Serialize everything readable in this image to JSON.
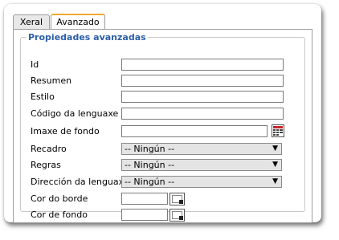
{
  "tabs": [
    {
      "label": "Xeral",
      "active": false
    },
    {
      "label": "Avanzado",
      "active": true
    }
  ],
  "fieldset": {
    "legend": "Propiedades avanzadas"
  },
  "fields": {
    "id": {
      "label": "Id",
      "value": ""
    },
    "resumen": {
      "label": "Resumen",
      "value": ""
    },
    "estilo": {
      "label": "Estilo",
      "value": ""
    },
    "codigo_lenguaxe": {
      "label": "Código da lenguaxe",
      "value": ""
    },
    "imaxe_fondo": {
      "label": "Imaxe de fondo",
      "value": ""
    },
    "recadro": {
      "label": "Recadro",
      "selected": "-- Ningún --"
    },
    "regras": {
      "label": "Regras",
      "selected": "-- Ningún --"
    },
    "direccion_lenguaxe": {
      "label": "Dirección da lenguaxe",
      "selected": "-- Ningún --"
    },
    "cor_borde": {
      "label": "Cor do borde",
      "value": ""
    },
    "cor_fondo": {
      "label": "Cor de fondo",
      "value": ""
    }
  },
  "icons": {
    "browse": "browse-icon",
    "color_picker": "color-picker-icon",
    "dropdown": "chevron-down-icon"
  },
  "colors": {
    "legend": "#2c5fa8",
    "active_tab_accent": "#f0a830"
  }
}
